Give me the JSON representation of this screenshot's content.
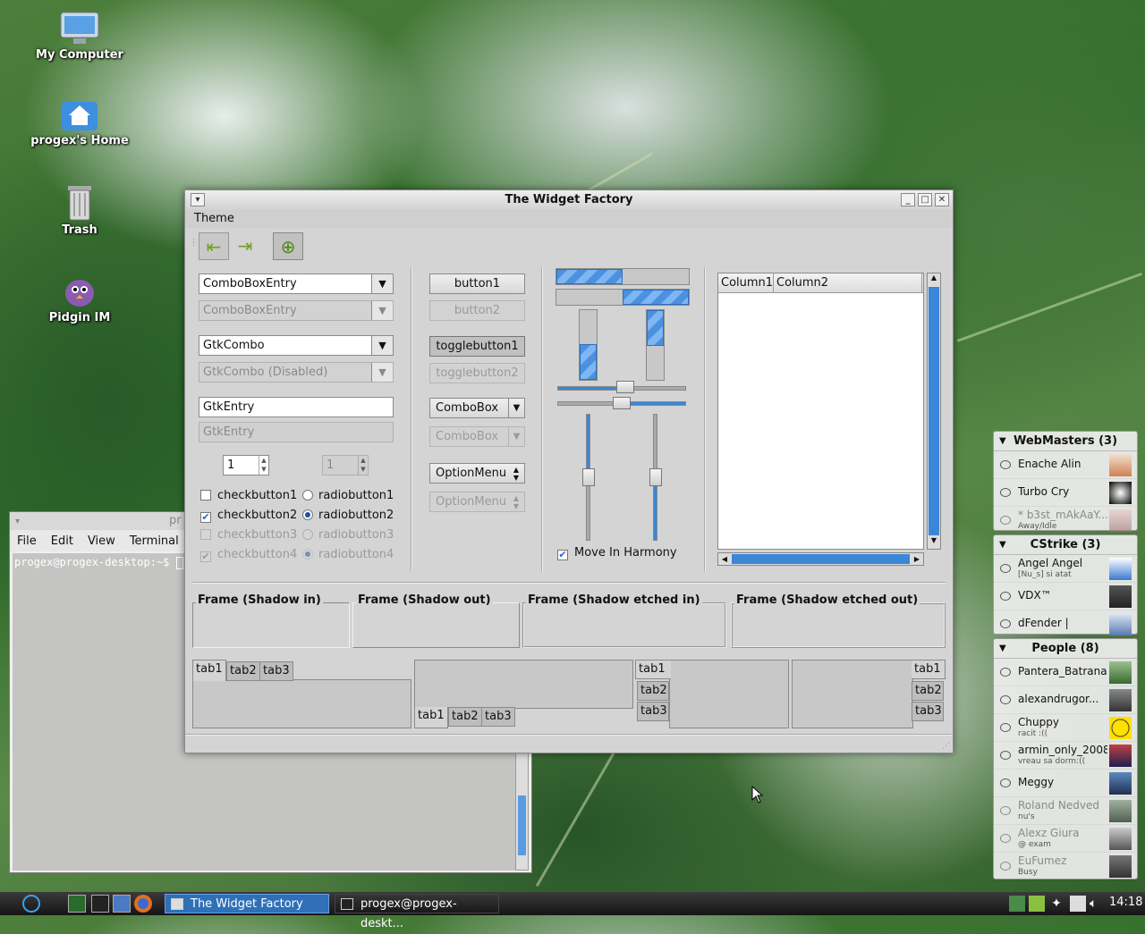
{
  "desktop": {
    "icons": [
      {
        "label": "My Computer",
        "icon": "computer-icon"
      },
      {
        "label": "progex's Home",
        "icon": "home-folder-icon"
      },
      {
        "label": "Trash",
        "icon": "trash-icon"
      },
      {
        "label": "Pidgin IM",
        "icon": "pidgin-icon"
      }
    ]
  },
  "terminal": {
    "title": "pr",
    "menu": [
      "File",
      "Edit",
      "View",
      "Terminal"
    ],
    "prompt": "progex@progex-desktop:~$ "
  },
  "window": {
    "title": "The Widget Factory",
    "menu": [
      "Theme"
    ],
    "combos": {
      "combo_entry": "ComboBoxEntry",
      "combo_entry_disabled": "ComboBoxEntry",
      "gtk_combo": "GtkCombo",
      "gtk_combo_disabled": "GtkCombo (Disabled)"
    },
    "entry": "GtkEntry",
    "entry_disabled": "GtkEntry",
    "spin": "1",
    "spin_disabled": "1",
    "checks": [
      {
        "label": "checkbutton1",
        "checked": false,
        "disabled": false
      },
      {
        "label": "checkbutton2",
        "checked": true,
        "disabled": false
      },
      {
        "label": "checkbutton3",
        "checked": false,
        "disabled": true
      },
      {
        "label": "checkbutton4",
        "checked": true,
        "disabled": true
      }
    ],
    "radios": [
      {
        "label": "radiobutton1",
        "checked": false,
        "disabled": false
      },
      {
        "label": "radiobutton2",
        "checked": true,
        "disabled": false
      },
      {
        "label": "radiobutton3",
        "checked": false,
        "disabled": true
      },
      {
        "label": "radiobutton4",
        "checked": true,
        "disabled": true
      }
    ],
    "buttons": {
      "button1": "button1",
      "button2": "button2",
      "toggle1": "togglebutton1",
      "toggle2": "togglebutton2",
      "combobox": "ComboBox",
      "combobox_disabled": "ComboBox",
      "optionmenu": "OptionMenu",
      "optionmenu_disabled": "OptionMenu"
    },
    "progress": {
      "horizontal_1": 0.5,
      "horizontal_2": 0.5,
      "vertical_1": 0.5,
      "vertical_2": 0.5
    },
    "scales": {
      "h1": 0.5,
      "h2": 0.5,
      "v1": 0.5,
      "v2": 0.5
    },
    "harmony_label": "Move In Harmony",
    "tree_columns": [
      "Column1",
      "Column2"
    ],
    "frames": [
      "Frame (Shadow in)",
      "Frame (Shadow out)",
      "Frame (Shadow etched in)",
      "Frame (Shadow etched out)"
    ],
    "tabs": [
      "tab1",
      "tab2",
      "tab3"
    ]
  },
  "buddy_list": {
    "groups": [
      {
        "name": "WebMasters (3)",
        "buddies": [
          {
            "name": "Enache Alin",
            "status": "",
            "idle": false
          },
          {
            "name": "Turbo Cry",
            "status": "",
            "idle": false
          },
          {
            "name": "* b3st_mAkAaY...",
            "status": "Away/Idle",
            "idle": true
          }
        ]
      },
      {
        "name": "CStrike (3)",
        "buddies": [
          {
            "name": "Angel Angel",
            "status": "[Nu_s] si atat",
            "idle": false
          },
          {
            "name": "VDX™",
            "status": "",
            "idle": false
          },
          {
            "name": "dFender |",
            "status": "",
            "idle": false
          }
        ]
      },
      {
        "name": "People (8)",
        "buddies": [
          {
            "name": "Pantera_Batrana",
            "status": "",
            "idle": false
          },
          {
            "name": "alexandrugor...",
            "status": "",
            "idle": false
          },
          {
            "name": "Chuppy",
            "status": "racit :((",
            "idle": false
          },
          {
            "name": "armin_only_2008",
            "status": "vreau sa dorm:((",
            "idle": false
          },
          {
            "name": "Meggy",
            "status": "",
            "idle": false
          },
          {
            "name": "Roland Nedved",
            "status": "nu's",
            "idle": true
          },
          {
            "name": "Alexz Giura",
            "status": "@ exam",
            "idle": true
          },
          {
            "name": "EuFumez",
            "status": "Busy",
            "idle": true
          }
        ]
      }
    ]
  },
  "taskbar": {
    "tasks": [
      {
        "label": "The Widget Factory",
        "active": true
      },
      {
        "label": "progex@progex-deskt...",
        "active": false
      }
    ],
    "clock": "14:18"
  }
}
